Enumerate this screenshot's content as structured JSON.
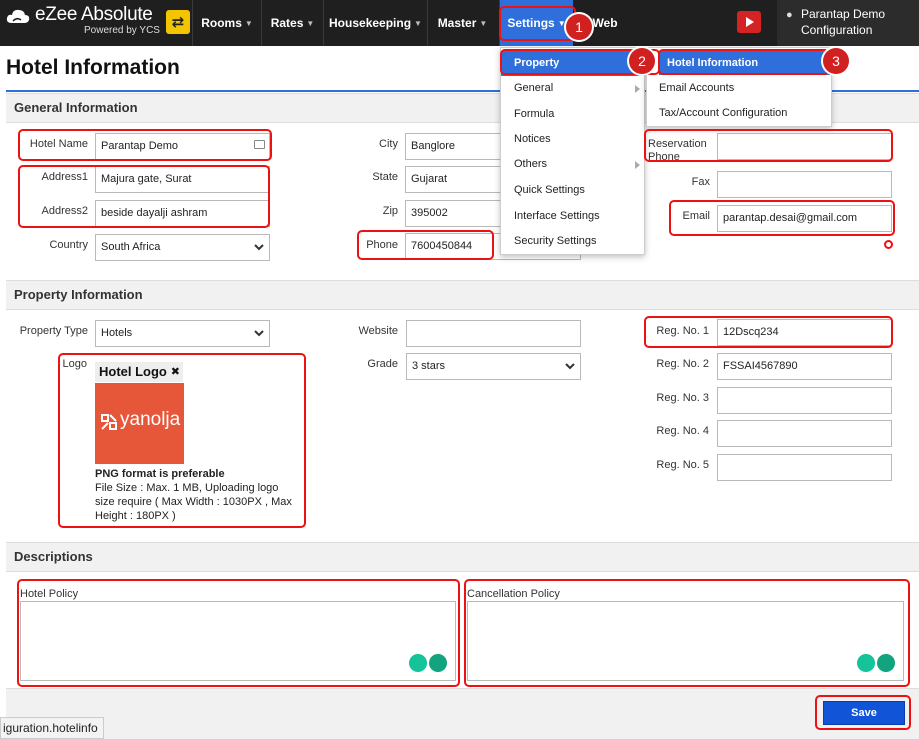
{
  "brand": {
    "title": "eZee Absolute",
    "subtitle": "Powered by YCS"
  },
  "nav": {
    "items": [
      {
        "label": "Rooms"
      },
      {
        "label": "Rates"
      },
      {
        "label": "Housekeeping"
      },
      {
        "label": "Master"
      },
      {
        "label": "Settings"
      },
      {
        "label": "Web"
      }
    ],
    "user_name": "Parantap Demo",
    "user_sub": "Configuration"
  },
  "page": {
    "title": "Hotel Information"
  },
  "settings_menu": {
    "items": [
      "Property",
      "General",
      "Formula",
      "Notices",
      "Others",
      "Quick Settings",
      "Interface Settings",
      "Security Settings"
    ]
  },
  "property_submenu": {
    "items": [
      "Hotel Information",
      "Email Accounts",
      "Tax/Account Configuration"
    ]
  },
  "badges": [
    "1",
    "2",
    "3"
  ],
  "general": {
    "section_title": "General Information",
    "hotel_name_label": "Hotel Name",
    "hotel_name": "Parantap Demo",
    "address1_label": "Address1",
    "address1": "Majura gate, Surat",
    "address2_label": "Address2",
    "address2": "beside dayalji ashram",
    "country_label": "Country",
    "country": "South Africa",
    "city_label": "City",
    "city": "Banglore",
    "state_label": "State",
    "state": "Gujarat",
    "zip_label": "Zip",
    "zip": "395002",
    "phone_label": "Phone",
    "phone": "7600450844",
    "res_phone_label_1": "Reservation",
    "res_phone_label_2": "Phone",
    "res_phone": "",
    "fax_label": "Fax",
    "fax": "",
    "email_label": "Email",
    "email": "parantap.desai@gmail.com"
  },
  "property": {
    "section_title": "Property Information",
    "type_label": "Property Type",
    "type": "Hotels",
    "logo_label": "Logo",
    "logo_card_title": "Hotel Logo",
    "logo_text": "yanolja",
    "logo_note_bold": "PNG format is preferable",
    "logo_note": "File Size : Max. 1 MB, Uploading logo size require ( Max Width : 1030PX , Max Height : 180PX )",
    "website_label": "Website",
    "website": "",
    "grade_label": "Grade",
    "grade": "3 stars",
    "reg_labels": [
      "Reg. No. 1",
      "Reg. No. 2",
      "Reg. No. 3",
      "Reg. No. 4",
      "Reg. No. 5"
    ],
    "reg_values": [
      "12Dscq234",
      "FSSAI4567890",
      "",
      "",
      ""
    ]
  },
  "descriptions": {
    "section_title": "Descriptions",
    "hotel_policy_label": "Hotel Policy",
    "cancellation_policy_label": "Cancellation Policy"
  },
  "actions": {
    "save_label": "Save"
  },
  "statusbar": {
    "text": "iguration.hotelinfo"
  },
  "colors": {
    "accent": "#2f6fdb",
    "highlight": "#e11111",
    "logo_bg": "#e6573a"
  }
}
